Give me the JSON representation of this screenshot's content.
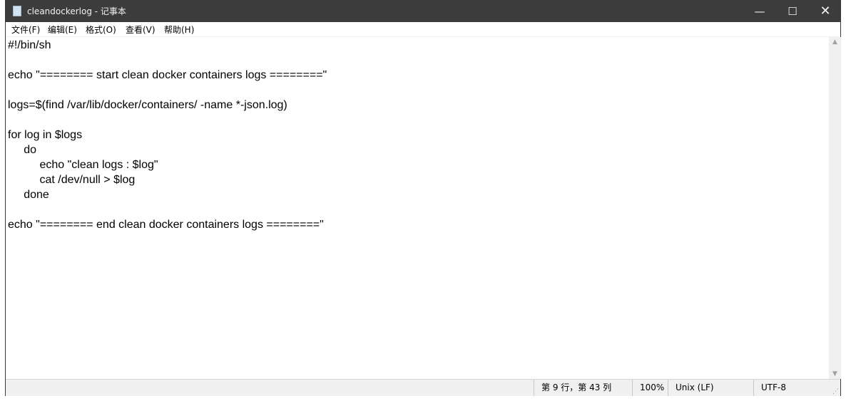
{
  "window": {
    "title": "cleandockerlog - 记事本",
    "controls": {
      "minimize": "—",
      "maximize": "☐",
      "close": "✕"
    }
  },
  "menu": [
    "文件(F)",
    "编辑(E)",
    "格式(O)",
    "查看(V)",
    "帮助(H)"
  ],
  "editor": {
    "content": "#!/bin/sh\n\necho \"======== start clean docker containers logs ========\"\n\nlogs=$(find /var/lib/docker/containers/ -name *-json.log)\n\nfor log in $logs\n\tdo\n\t\techo \"clean logs : $log\"\n\t\tcat /dev/null > $log\n\tdone\n\necho \"======== end clean docker containers logs ========\""
  },
  "status": {
    "position": "第 9 行，第 43 列",
    "zoom": "100%",
    "line_ending": "Unix (LF)",
    "encoding": "UTF-8"
  }
}
